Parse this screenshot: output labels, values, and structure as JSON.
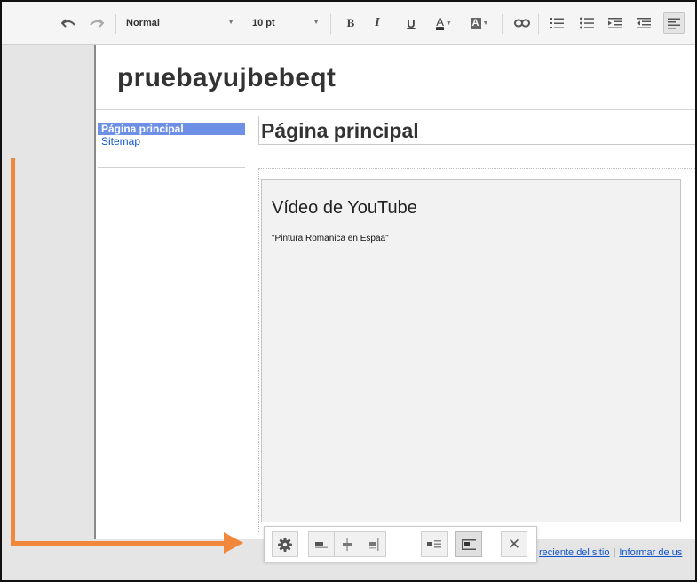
{
  "toolbar": {
    "style_value": "Normal",
    "font_size_value": "10 pt",
    "bold_label": "B",
    "italic_label": "I",
    "underline_label": "U",
    "text_color_label": "A",
    "highlight_label": "A"
  },
  "site": {
    "title": "pruebayujbebeqt"
  },
  "sidebar": {
    "items": [
      {
        "label": "Página principal",
        "selected": true
      },
      {
        "label": "Sitemap",
        "selected": false
      }
    ]
  },
  "page": {
    "title": "Página principal"
  },
  "gadget": {
    "title": "Vídeo de YouTube",
    "subtitle": "\"Pintura Romanica en Espaa\""
  },
  "gadget_toolbar": {
    "close_label": "✕"
  },
  "footer": {
    "recent_activity": "reciente del sitio",
    "separator": "|",
    "report_abuse": "Informar de us"
  },
  "colors": {
    "accent_arrow": "#f0873a",
    "nav_selected": "#6d8fe6",
    "link": "#1155cc"
  }
}
